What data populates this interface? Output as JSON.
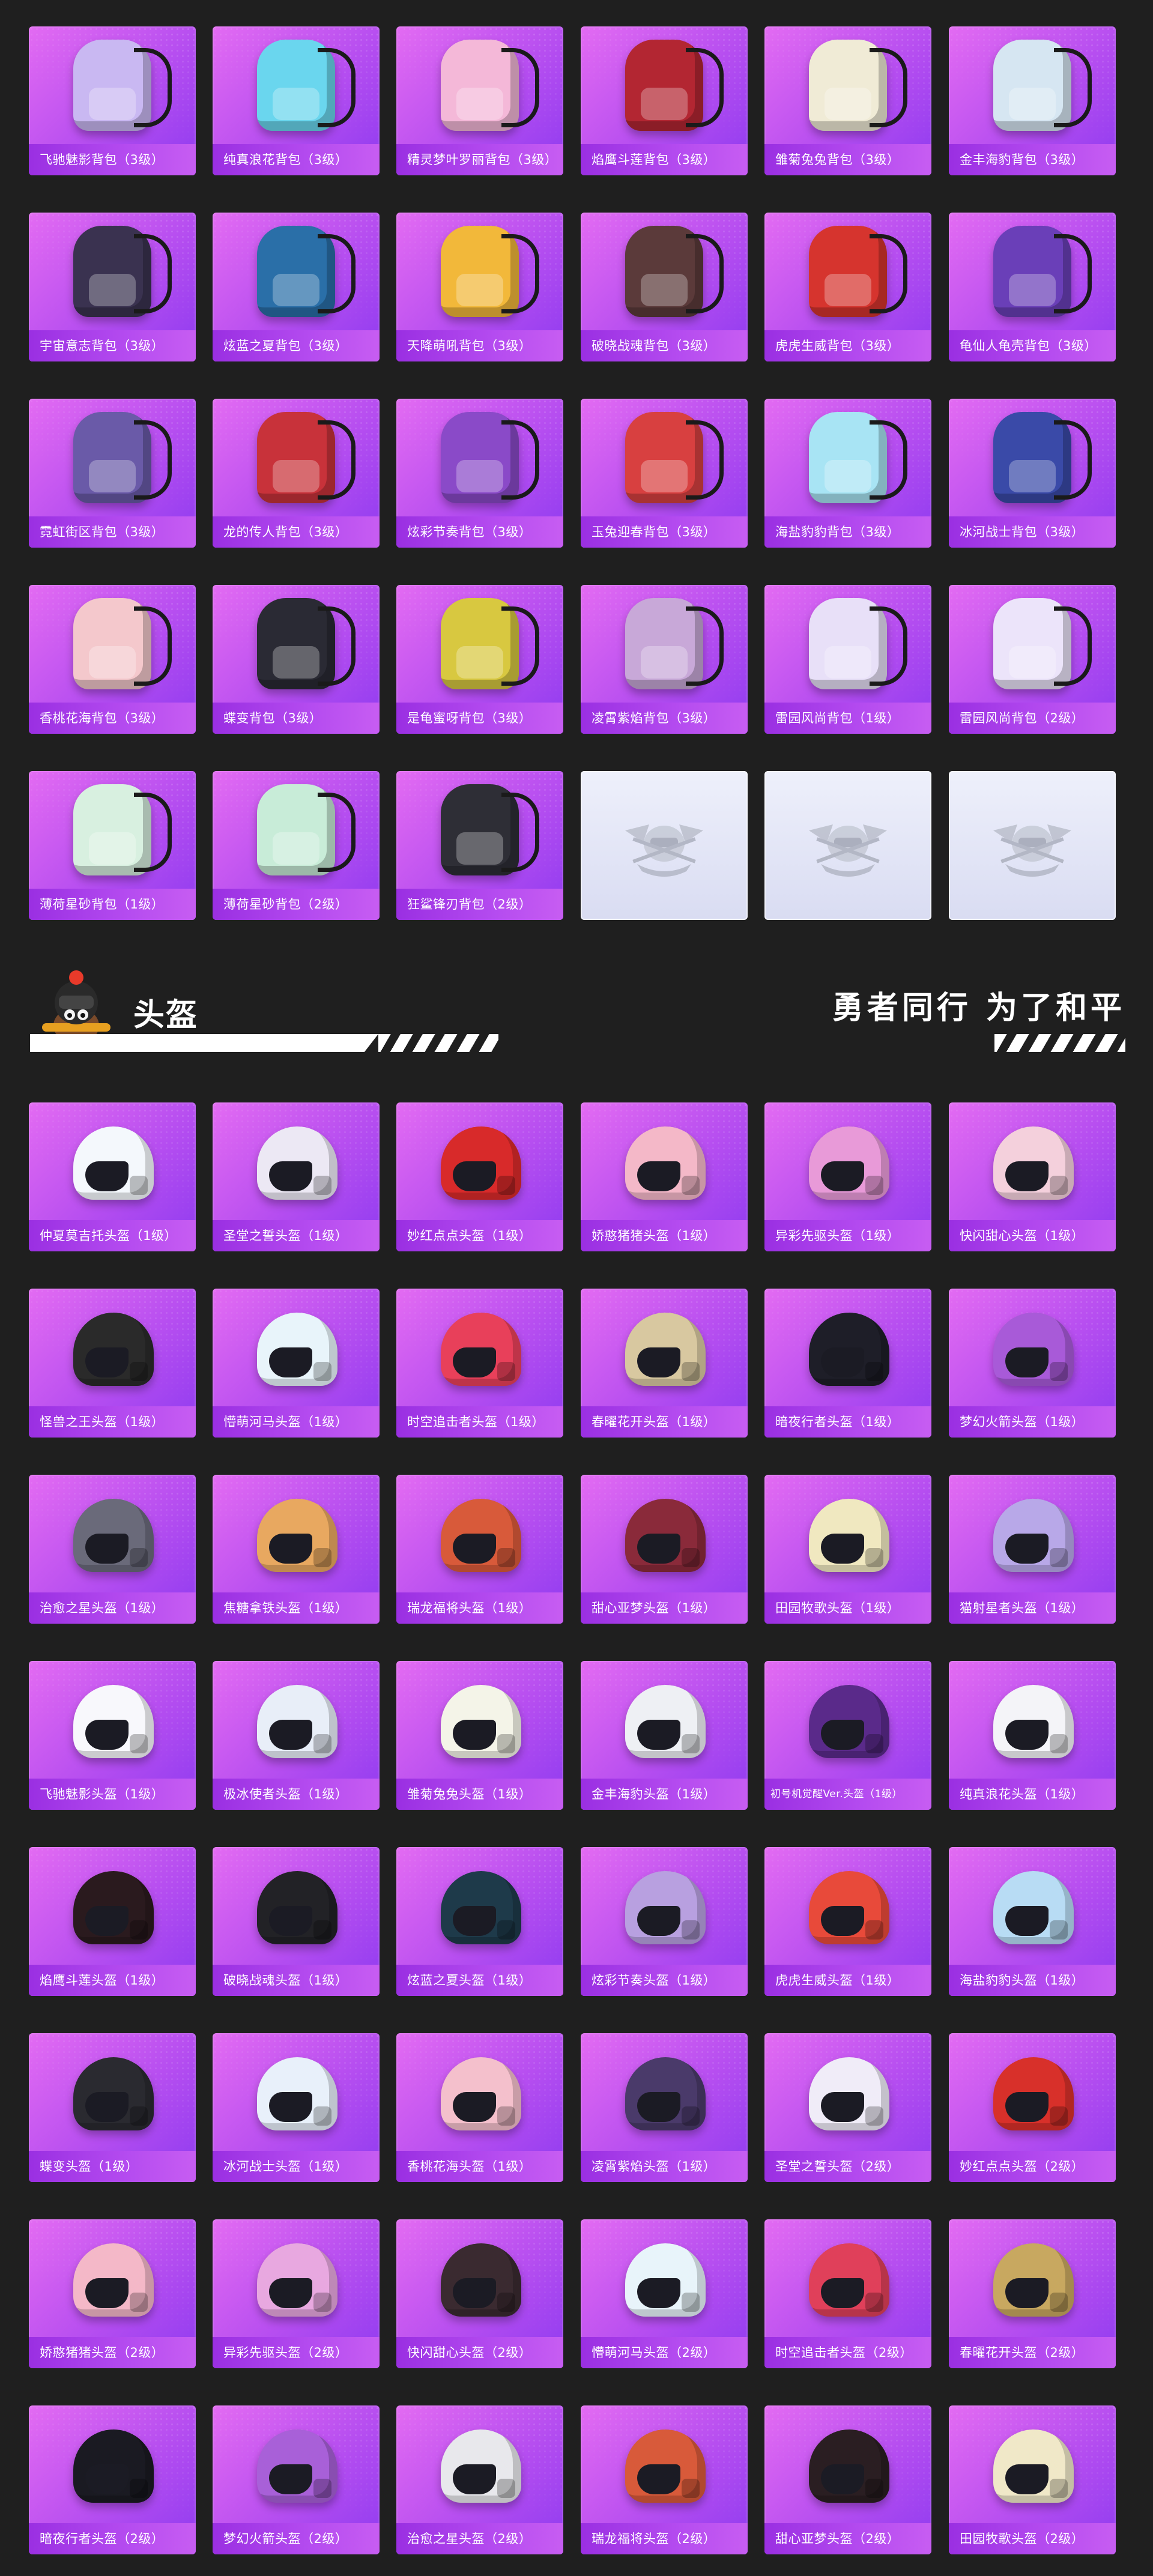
{
  "section": {
    "title": "头盔",
    "slogan": "勇者同行 为了和平"
  },
  "backpacks": [
    {
      "name": "飞驰魅影背包（3级）",
      "color": "#c9b8f2"
    },
    {
      "name": "纯真浪花背包（3级）",
      "color": "#6ad6ee"
    },
    {
      "name": "精灵梦叶罗丽背包（3级）",
      "color": "#f4b8d8"
    },
    {
      "name": "焰鹰斗莲背包（3级）",
      "color": "#b32632"
    },
    {
      "name": "雏菊兔兔背包（3级）",
      "color": "#f0ebd6"
    },
    {
      "name": "金丰海豹背包（3级）",
      "color": "#d6e6f2"
    },
    {
      "name": "宇宙意志背包（3级）",
      "color": "#3a3250"
    },
    {
      "name": "炫蓝之夏背包（3级）",
      "color": "#2a6fa8"
    },
    {
      "name": "天降萌吼背包（3级）",
      "color": "#f2b83a"
    },
    {
      "name": "破晓战魂背包（3级）",
      "color": "#5b3a3a"
    },
    {
      "name": "虎虎生威背包（3级）",
      "color": "#d6342e"
    },
    {
      "name": "龟仙人龟壳背包（3级）",
      "color": "#6a3fb8"
    },
    {
      "name": "霓虹街区背包（3级）",
      "color": "#6a5aa8"
    },
    {
      "name": "龙的传人背包（3级）",
      "color": "#c8323a"
    },
    {
      "name": "炫彩节奏背包（3级）",
      "color": "#8a4ac8"
    },
    {
      "name": "玉兔迎春背包（3级）",
      "color": "#d84040"
    },
    {
      "name": "海盐豹豹背包（3级）",
      "color": "#a8e4f4"
    },
    {
      "name": "冰河战士背包（3级）",
      "color": "#3a4aa8"
    },
    {
      "name": "香桃花海背包（3级）",
      "color": "#f4c8cc"
    },
    {
      "name": "蝶变背包（3级）",
      "color": "#2a2a34"
    },
    {
      "name": "是龟蜜呀背包（3级）",
      "color": "#d8c840"
    },
    {
      "name": "凌霄紫焰背包（3级）",
      "color": "#c8a8d8"
    },
    {
      "name": "雷园风尚背包（1级）",
      "color": "#e8e0f8"
    },
    {
      "name": "雷园风尚背包（2级）",
      "color": "#ece4fa"
    },
    {
      "name": "薄荷星砂背包（1级）",
      "color": "#d8f0e0"
    },
    {
      "name": "薄荷星砂背包（2级）",
      "color": "#c8ecd8"
    },
    {
      "name": "狂鲨锋刃背包（2级）",
      "color": "#2e2e36"
    }
  ],
  "placeholders": 3,
  "helmets": [
    {
      "name": "仲夏莫吉托头盔（1级）",
      "color": "#f4f8fc"
    },
    {
      "name": "圣堂之誓头盔（1级）",
      "color": "#ece8f4"
    },
    {
      "name": "妙红点点头盔（1级）",
      "color": "#d82a2a"
    },
    {
      "name": "娇憨猪猪头盔（1级）",
      "color": "#f4b8c8"
    },
    {
      "name": "异彩先驱头盔（1级）",
      "color": "#e89ad8"
    },
    {
      "name": "快闪甜心头盔（1级）",
      "color": "#f4d0dc"
    },
    {
      "name": "怪兽之王头盔（1级）",
      "color": "#2a2a2a"
    },
    {
      "name": "懵萌河马头盔（1级）",
      "color": "#e8f4fa"
    },
    {
      "name": "时空追击者头盔（1级）",
      "color": "#e8405a"
    },
    {
      "name": "春曜花开头盔（1级）",
      "color": "#d8c8a0"
    },
    {
      "name": "暗夜行者头盔（1级）",
      "color": "#1e1e28"
    },
    {
      "name": "梦幻火箭头盔（1级）",
      "color": "#a85ad8"
    },
    {
      "name": "治愈之星头盔（1级）",
      "color": "#6a6a7a"
    },
    {
      "name": "焦糖拿铁头盔（1级）",
      "color": "#e8a860"
    },
    {
      "name": "瑞龙福将头盔（1级）",
      "color": "#d85a3a"
    },
    {
      "name": "甜心亚梦头盔（1级）",
      "color": "#8a2a3a"
    },
    {
      "name": "田园牧歌头盔（1级）",
      "color": "#f0e8c0"
    },
    {
      "name": "猫射星者头盔（1级）",
      "color": "#b8a8e8"
    },
    {
      "name": "飞驰魅影头盔（1级）",
      "color": "#f8f8fc"
    },
    {
      "name": "极冰使者头盔（1级）",
      "color": "#e8eef8"
    },
    {
      "name": "雏菊兔兔头盔（1级）",
      "color": "#f4f4e8"
    },
    {
      "name": "金丰海豹头盔（1级）",
      "color": "#eef0f4"
    },
    {
      "name": "初号机觉醒Ver.头盔（1级）",
      "color": "#5a2a8a"
    },
    {
      "name": "纯真浪花头盔（1级）",
      "color": "#f4f4f8"
    },
    {
      "name": "焰鹰斗莲头盔（1级）",
      "color": "#2a1a1e"
    },
    {
      "name": "破晓战魂头盔（1级）",
      "color": "#222226"
    },
    {
      "name": "炫蓝之夏头盔（1级）",
      "color": "#1e3a4a"
    },
    {
      "name": "炫彩节奏头盔（1级）",
      "color": "#b8a0e0"
    },
    {
      "name": "虎虎生威头盔（1级）",
      "color": "#e84a3a"
    },
    {
      "name": "海盐豹豹头盔（1级）",
      "color": "#b8dcf4"
    },
    {
      "name": "蝶变头盔（1级）",
      "color": "#2a2a30"
    },
    {
      "name": "冰河战士头盔（1级）",
      "color": "#e8f0fa"
    },
    {
      "name": "香桃花海头盔（1级）",
      "color": "#f4c0cc"
    },
    {
      "name": "凌霄紫焰头盔（1级）",
      "color": "#4a3a6a"
    },
    {
      "name": "圣堂之誓头盔（2级）",
      "color": "#f0ecf8"
    },
    {
      "name": "妙红点点头盔（2级）",
      "color": "#d8302a"
    },
    {
      "name": "娇憨猪猪头盔（2级）",
      "color": "#f4b8c8"
    },
    {
      "name": "异彩先驱头盔（2级）",
      "color": "#e8a8e0"
    },
    {
      "name": "快闪甜心头盔（2级）",
      "color": "#3a2a30"
    },
    {
      "name": "懵萌河马头盔（2级）",
      "color": "#e8f4fa"
    },
    {
      "name": "时空追击者头盔（2级）",
      "color": "#e0405a"
    },
    {
      "name": "春曜花开头盔（2级）",
      "color": "#c8a860"
    },
    {
      "name": "暗夜行者头盔（2级）",
      "color": "#1a1a22"
    },
    {
      "name": "梦幻火箭头盔（2级）",
      "color": "#a860d8"
    },
    {
      "name": "治愈之星头盔（2级）",
      "color": "#e8e8ec"
    },
    {
      "name": "瑞龙福将头盔（2级）",
      "color": "#d85a3a"
    },
    {
      "name": "甜心亚梦头盔（2级）",
      "color": "#2a1e22"
    },
    {
      "name": "田园牧歌头盔（2级）",
      "color": "#f0e8c8"
    }
  ]
}
